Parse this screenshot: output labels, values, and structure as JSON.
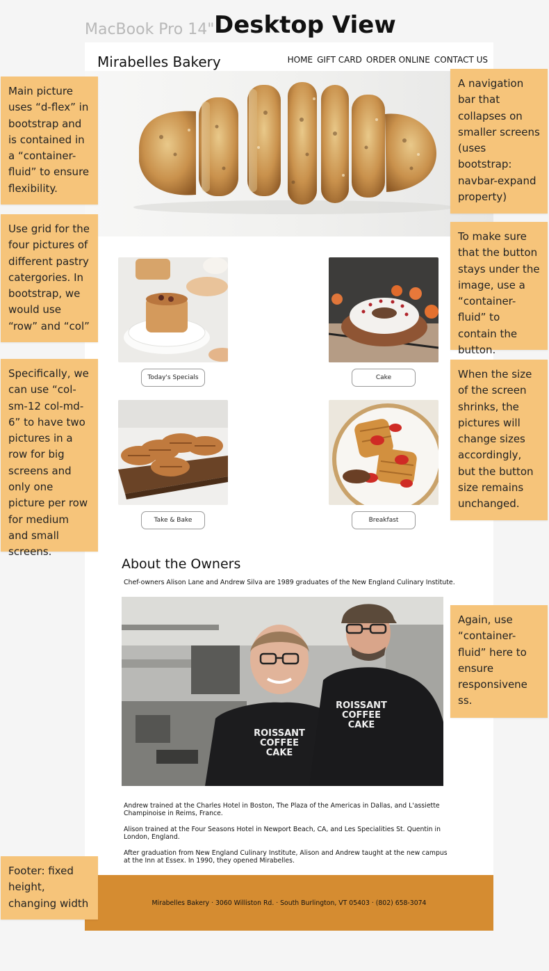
{
  "frame_label": "MacBook Pro 14\"",
  "view_title": "Desktop View",
  "site": {
    "brand": "Mirabelles Bakery",
    "nav": [
      "HOME",
      "GIFT CARD",
      "ORDER ONLINE",
      "CONTACT US"
    ]
  },
  "categories": [
    {
      "button": "Today's Specials"
    },
    {
      "button": "Cake"
    },
    {
      "button": "Take & Bake"
    },
    {
      "button": "Breakfast"
    }
  ],
  "about": {
    "title": "About the Owners",
    "intro": "Chef-owners Alison Lane and Andrew Silva are 1989 graduates of the New England Culinary Institute.",
    "shirt_text": [
      "ROISSANT",
      "COFFEE",
      "CAKE"
    ],
    "paragraphs": [
      "Andrew trained at the Charles Hotel in Boston, The Plaza of the Americas in Dallas, and L'assiette Champinoise in Reims, France.",
      "Alison trained at the Four Seasons Hotel in Newport Beach, CA, and Les Specialities St. Quentin in London, England.",
      "After graduation from New England Culinary Institute, Alison and Andrew taught at the new campus at the Inn at Essex. In 1990, they opened Mirabelles."
    ]
  },
  "footer": {
    "text": "Mirabelles Bakery · 3060 Williston Rd. · South Burlington, VT 05403 · (802) 658-3074"
  },
  "notes": {
    "left": [
      "Main picture uses “d-flex” in bootstrap and is contained in a “container-fluid” to ensure flexibility.",
      "Use grid for the four pictures of different pastry catergories. In bootstrap, we would use “row” and “col”",
      "Specifically, we can use “col-sm-12 col-md-6” to have two pictures in a row for big screens and only one picture per row for medium and small screens.",
      "Footer: fixed height, changing width"
    ],
    "right": [
      "A navigation bar that collapses on smaller screens (uses bootstrap: navbar-expand property)",
      "To make sure that the button stays under the image, use a “container-fluid” to contain the button.",
      "When the size of the screen shrinks, the pictures will change sizes accordingly, but the button size remains unchanged.",
      "Again, use “container-fluid” here to ensure responsivene ss."
    ]
  },
  "colors": {
    "sticky_note": "#f6c47a",
    "footer_bg": "#d58c31",
    "canvas_bg": "#f5f5f5"
  }
}
